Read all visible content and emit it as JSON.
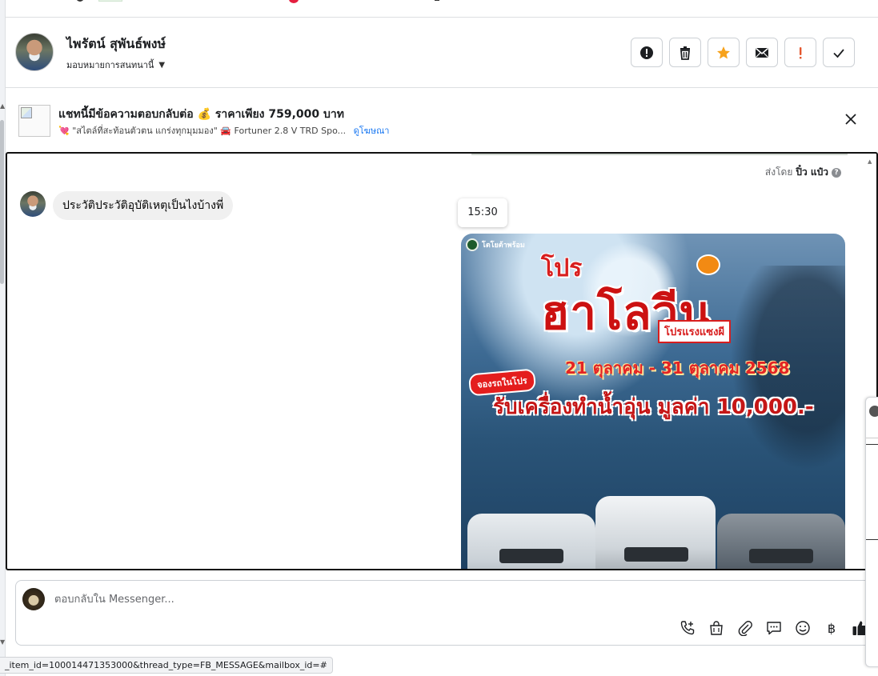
{
  "header": {
    "contact_name": "ไพรัตน์ สุพันธ์พงษ์",
    "assign_label": "มอบหมายการสนทนานี้",
    "toolbar": [
      {
        "icon": "alert-circle-icon",
        "name": "mark-spam-button"
      },
      {
        "icon": "trash-icon",
        "name": "delete-button"
      },
      {
        "icon": "star-icon",
        "name": "star-button"
      },
      {
        "icon": "envelope-icon",
        "name": "mark-unread-button"
      },
      {
        "icon": "exclamation-icon",
        "name": "follow-up-button"
      },
      {
        "icon": "check-icon",
        "name": "mark-done-button"
      }
    ]
  },
  "ad_context": {
    "title": "แชทนี้มีข้อความตอบกลับต่อ 💰 ราคาเพียง 759,000 บาท",
    "subtitle": "💘 \"สไตล์ที่สะท้อนตัวตน แกร่งทุกมุมมอง\" 🚘 Fortuner 2.8 V TRD Spo...",
    "link": "ดูโฆษณา"
  },
  "chat": {
    "sent_by_prefix": "ส่งโดย",
    "sent_by_name": "ปิ๋ว แป๋ว",
    "help_glyph": "?",
    "incoming_message": "ประวัติประวัติอุบัติเหตุเป็นไงบ้างพี่",
    "timestamp": "15:30",
    "poster": {
      "brand": "โตโยต้าพร้อม",
      "headline_top": "โปร",
      "headline": "ฮาโลวีน",
      "tagline": "โปรแรงแซงผี",
      "dates": "21 ตุลาคม - 31 ตุลาคม 2568",
      "pill": "จองรถในโปร",
      "offer": "รับเครื่องทำน้ำอุ่น มูลค่า 10,000.-"
    }
  },
  "composer": {
    "placeholder": "ตอบกลับใน Messenger...",
    "actions": [
      "phone-plus-icon",
      "shopping-bag-icon",
      "paperclip-icon",
      "chat-bubble-icon",
      "smile-icon",
      "baht-icon",
      "thumbs-up-icon"
    ],
    "baht_glyph": "฿"
  },
  "status_bar": {
    "url": "_item_id=100014471353000&thread_type=FB_MESSAGE&mailbox_id=#"
  },
  "colors": {
    "accent": "#1877f2",
    "star": "#f7a21b",
    "followup": "#e4572e",
    "like": "#1c1e21"
  }
}
